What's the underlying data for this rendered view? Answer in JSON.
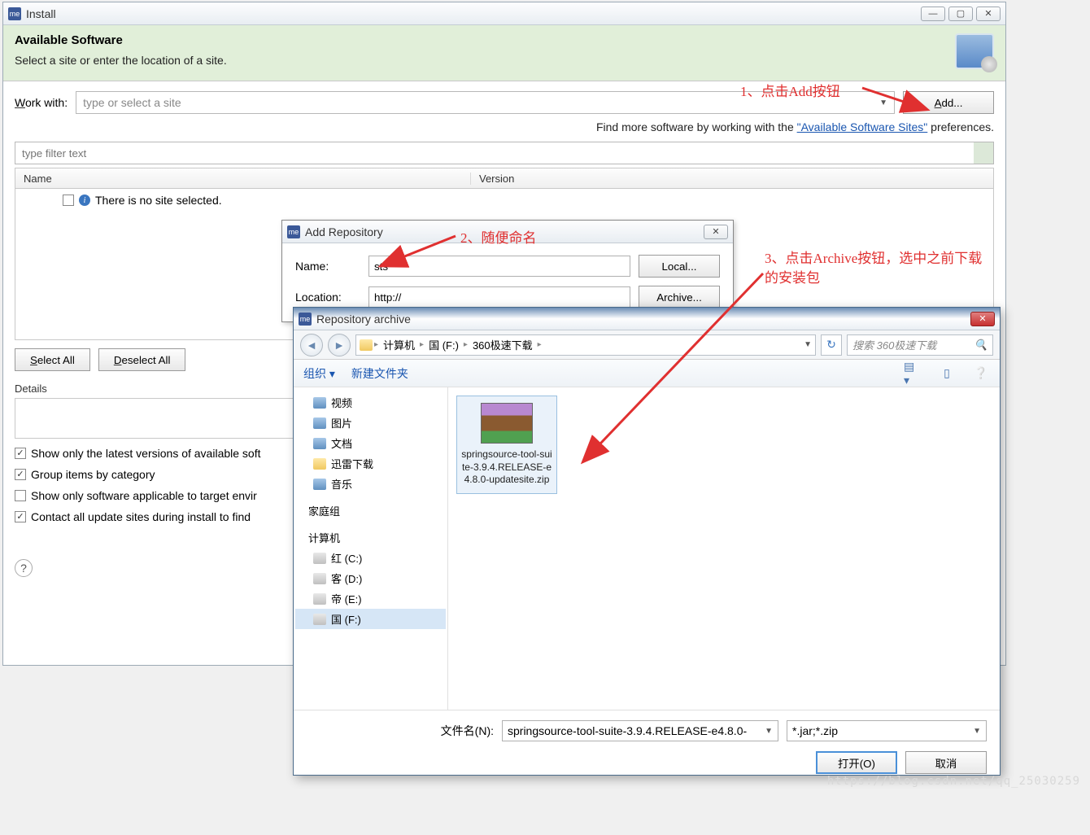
{
  "install": {
    "window_title": "Install",
    "header_title": "Available Software",
    "header_sub": "Select a site or enter the location of a site.",
    "workwith_label": "Work with:",
    "workwith_placeholder": "type or select a site",
    "add_button": "Add...",
    "find_prefix": "Find more software by working with the ",
    "find_link": "\"Available Software Sites\"",
    "find_suffix": " preferences.",
    "filter_placeholder": "type filter text",
    "col_name": "Name",
    "col_version": "Version",
    "no_site": "There is no site selected.",
    "select_all": "Select All",
    "deselect_all": "Deselect All",
    "details_label": "Details",
    "checks": {
      "latest": "Show only the latest versions of available soft",
      "group": "Group items by category",
      "applicable": "Show only software applicable to target envir",
      "contact": "Contact all update sites during install to find"
    }
  },
  "addrepo": {
    "title": "Add Repository",
    "name_label": "Name:",
    "name_value": "sts",
    "loc_label": "Location:",
    "loc_value": "http://",
    "local_btn": "Local...",
    "archive_btn": "Archive..."
  },
  "filedlg": {
    "title": "Repository archive",
    "breadcrumb": [
      "计算机",
      "国 (F:)",
      "360极速下载"
    ],
    "search_placeholder": "搜索 360极速下载",
    "organize": "组织",
    "newfolder": "新建文件夹",
    "tree": {
      "favorites": [
        "视频",
        "图片",
        "文档",
        "迅雷下载",
        "音乐"
      ],
      "homegroup": "家庭组",
      "computer": "计算机",
      "drives": [
        "红 (C:)",
        "客 (D:)",
        "帝 (E:)",
        "国 (F:)"
      ]
    },
    "file_name": "springsource-tool-suite-3.9.4.RELEASE-e4.8.0-updatesite.zip",
    "filename_label": "文件名(N):",
    "filename_value": "springsource-tool-suite-3.9.4.RELEASE-e4.8.0-",
    "filter": "*.jar;*.zip",
    "open_btn": "打开(O)",
    "cancel_btn": "取消"
  },
  "annotations": {
    "a1": "1、点击Add按钮",
    "a2": "2、随便命名",
    "a3": "3、点击Archive按钮，选中之前下载的安装包"
  },
  "watermark": "https://blog.csdn.net/qq_25030259"
}
